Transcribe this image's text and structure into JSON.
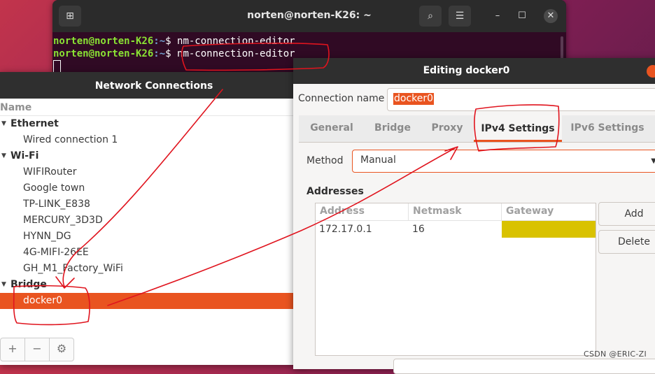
{
  "terminal": {
    "title": "norten@norten-K26: ~",
    "lines": [
      {
        "user": "norten@norten-K26",
        "path": ":~",
        "prompt": "$ ",
        "cmd": "nm-connection-editor"
      },
      {
        "user": "norten@norten-K26",
        "path": ":~",
        "prompt": "$ ",
        "cmd": "nm-connection-editor"
      }
    ],
    "icons": {
      "new_tab": "new-tab-icon",
      "search": "search-icon",
      "menu": "hamburger-menu-icon",
      "minimize": "minimize-icon",
      "maximize": "maximize-icon",
      "close": "close-icon"
    },
    "glyphs": {
      "new_tab": "⊞",
      "search": "⌕",
      "menu": "☰",
      "minimize": "–",
      "maximize": "☐",
      "close": "✕"
    }
  },
  "network_connections": {
    "title": "Network Connections",
    "column_header": "Name",
    "groups": [
      {
        "name": "Ethernet",
        "items": [
          "Wired connection 1"
        ]
      },
      {
        "name": "Wi-Fi",
        "items": [
          "WIFIRouter",
          "Google town",
          "TP-LINK_E838",
          "MERCURY_3D3D",
          "HYNN_DG",
          "4G-MIFI-26EE",
          "GH_M1_Factory_WiFi"
        ]
      },
      {
        "name": "Bridge",
        "items": [
          "docker0"
        ]
      }
    ],
    "selected": "docker0",
    "toolbar": {
      "add": "+",
      "remove": "−",
      "settings": "⚙"
    }
  },
  "editor": {
    "title": "Editing docker0",
    "connection_name_label": "Connection name",
    "connection_name_value": "docker0",
    "tabs": [
      "General",
      "Bridge",
      "Proxy",
      "IPv4 Settings",
      "IPv6 Settings"
    ],
    "active_tab": "IPv4 Settings",
    "method_label": "Method",
    "method_value": "Manual",
    "addresses_label": "Addresses",
    "address_columns": [
      "Address",
      "Netmask",
      "Gateway"
    ],
    "address_rows": [
      {
        "address": "172.17.0.1",
        "netmask": "16",
        "gateway": ""
      }
    ],
    "add_button": "Add",
    "delete_button": "Delete",
    "dropdown_arrow": "▼"
  },
  "watermark": "CSDN @ERIC-ZI",
  "colors": {
    "accent": "#e95420",
    "annotation": "#e0141e",
    "gateway_highlight": "#d9c200",
    "terminal_bg": "#300a24"
  }
}
